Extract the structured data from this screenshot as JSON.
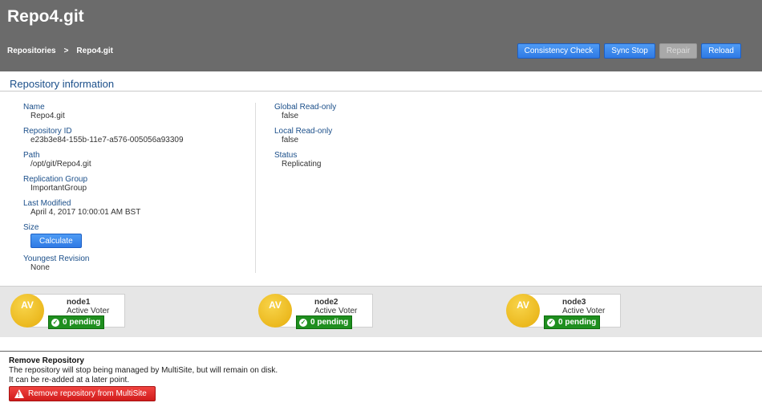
{
  "header": {
    "title": "Repo4.git",
    "breadcrumb": {
      "root": "Repositories",
      "separator": ">",
      "current": "Repo4.git"
    },
    "buttons": {
      "consistency_check": "Consistency Check",
      "sync_stop": "Sync Stop",
      "repair": "Repair",
      "reload": "Reload"
    }
  },
  "info": {
    "title": "Repository information",
    "left": [
      {
        "label": "Name",
        "value": "Repo4.git"
      },
      {
        "label": "Repository ID",
        "value": "e23b3e84-155b-11e7-a576-005056a93309"
      },
      {
        "label": "Path",
        "value": "/opt/git/Repo4.git"
      },
      {
        "label": "Replication Group",
        "value": "ImportantGroup"
      },
      {
        "label": "Last Modified",
        "value": "April 4, 2017 10:00:01 AM BST"
      }
    ],
    "size": {
      "label": "Size",
      "button": "Calculate"
    },
    "youngest_revision": {
      "label": "Youngest Revision",
      "value": "None"
    },
    "right": [
      {
        "label": "Global Read-only",
        "value": "false"
      },
      {
        "label": "Local Read-only",
        "value": "false"
      },
      {
        "label": "Status",
        "value": "Replicating"
      }
    ]
  },
  "nodes": [
    {
      "avatar": "AV",
      "name": "node1",
      "role": "Active Voter",
      "pending": "0 pending"
    },
    {
      "avatar": "AV",
      "name": "node2",
      "role": "Active Voter",
      "pending": "0 pending"
    },
    {
      "avatar": "AV",
      "name": "node3",
      "role": "Active Voter",
      "pending": "0 pending"
    }
  ],
  "remove": {
    "title": "Remove Repository",
    "line1": "The repository will stop being managed by MultiSite, but will remain on disk.",
    "line2": "It can be re-added at a later point.",
    "button": "Remove repository from MultiSite"
  },
  "colors": {
    "header_bg": "#6b6b6b",
    "accent_blue": "#2f7ae5",
    "label_blue": "#1b4f8a",
    "pending_green": "#1f8f1f",
    "danger_red": "#d11c1c",
    "avatar_yellow": "#f0c020"
  },
  "icons": {
    "check": "check-circle-icon",
    "warning": "warning-triangle-icon"
  }
}
